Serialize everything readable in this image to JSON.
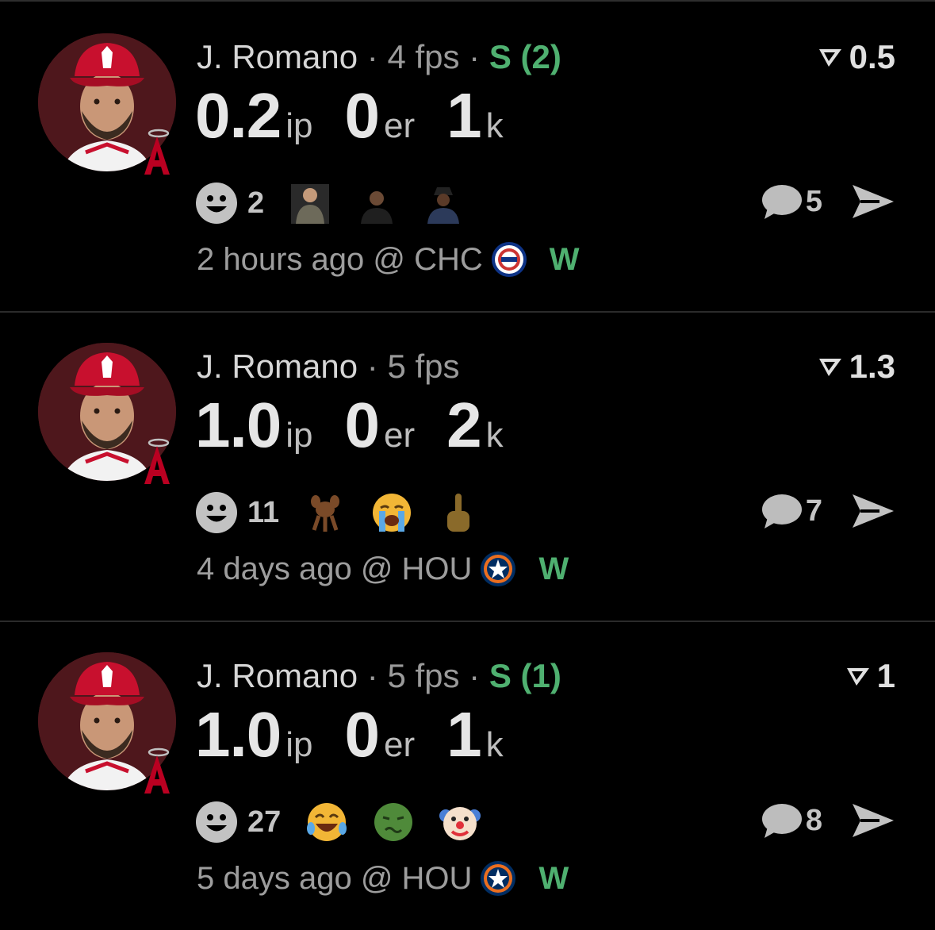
{
  "feed": {
    "cards": [
      {
        "player_name": "J. Romano",
        "fps": "4 fps",
        "save": "S (2)",
        "points": "0.5",
        "ip": "0.2",
        "ip_unit": "ip",
        "er": "0",
        "er_unit": "er",
        "k": "1",
        "k_unit": "k",
        "reaction_count": "2",
        "reactions": [
          "man-gif",
          "man-gif",
          "man-gif"
        ],
        "comment_count": "5",
        "time": "2 hours ago",
        "opponent": "@ CHC",
        "opponent_logo": "cubs-logo",
        "result": "W"
      },
      {
        "player_name": "J. Romano",
        "fps": "5 fps",
        "save": "",
        "points": "1.3",
        "ip": "1.0",
        "ip_unit": "ip",
        "er": "0",
        "er_unit": "er",
        "k": "2",
        "k_unit": "k",
        "reaction_count": "11",
        "reactions": [
          "cartoon-rat",
          "loudly-crying-face",
          "middle-finger"
        ],
        "comment_count": "7",
        "time": "4 days ago",
        "opponent": "@ HOU",
        "opponent_logo": "astros-logo",
        "result": "W"
      },
      {
        "player_name": "J. Romano",
        "fps": "5 fps",
        "save": "S (1)",
        "points": "1",
        "ip": "1.0",
        "ip_unit": "ip",
        "er": "0",
        "er_unit": "er",
        "k": "1",
        "k_unit": "k",
        "reaction_count": "27",
        "reactions": [
          "tears-of-joy-face",
          "nauseated-face",
          "clown-face"
        ],
        "comment_count": "8",
        "time": "5 days ago",
        "opponent": "@ HOU",
        "opponent_logo": "astros-logo",
        "result": "W"
      }
    ]
  },
  "colors": {
    "background": "#000000",
    "save_green": "#4fb070",
    "result_green": "#4fb070",
    "muted_text": "#9a9a9a",
    "avatar_bg": "#5a1a1f",
    "angels_red": "#ba0021"
  },
  "separators": {
    "dot": "·"
  }
}
